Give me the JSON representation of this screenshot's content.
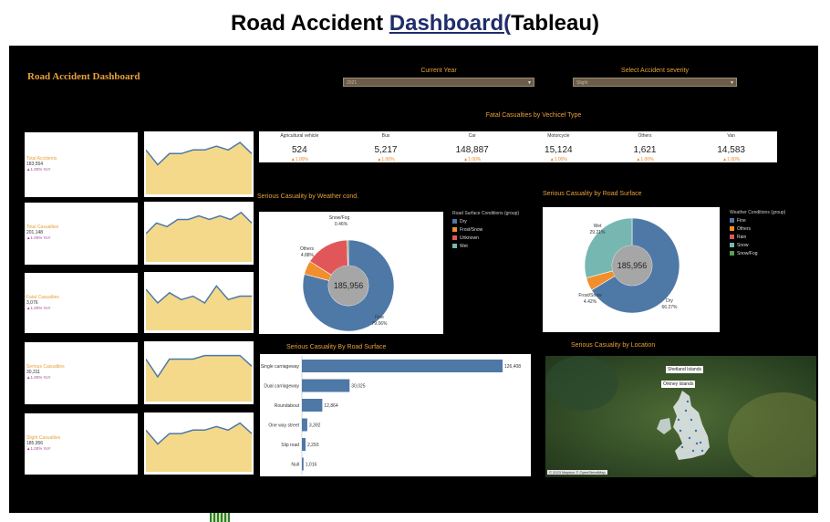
{
  "page_title": {
    "part1": "Road Accid",
    "part2": "ent ",
    "part3": "Dashboard(",
    "part4": "Tableau)"
  },
  "dashboard": {
    "title": "Road Accident Dashboard",
    "filters": {
      "current_year": {
        "label": "Current Year",
        "value": "2021"
      },
      "severity": {
        "label": "Select Accident severity",
        "value": "Slight"
      }
    },
    "kpis": [
      {
        "label": "Total Accidents",
        "value": "183,554",
        "delta": "▲1.00% YoY"
      },
      {
        "label": "Total Casualties",
        "value": "201,148",
        "delta": "▲1.00% YoY"
      },
      {
        "label": "Fatal Casualties",
        "value": "3,076",
        "delta": "▲1.00% YoY"
      },
      {
        "label": "Serious Casualties",
        "value": "30,311",
        "delta": "▲1.00% YoY"
      },
      {
        "label": "Slight Casualties",
        "value": "185,956",
        "delta": "▲1.00% YoY"
      }
    ],
    "vehicle_table": {
      "title": "Fatal Casualties by Vechicel Type",
      "columns": [
        {
          "name": "Agricultural vehicle",
          "value": "524",
          "delta": "▲1.00%"
        },
        {
          "name": "Bus",
          "value": "5,217",
          "delta": "▲1.00%"
        },
        {
          "name": "Car",
          "value": "148,887",
          "delta": "▲1.00%"
        },
        {
          "name": "Motorcycle",
          "value": "15,124",
          "delta": "▲1.00%"
        },
        {
          "name": "Others",
          "value": "1,621",
          "delta": "▲1.00%"
        },
        {
          "name": "Van",
          "value": "14,583",
          "delta": "▲1.00%"
        }
      ]
    },
    "donut1": {
      "title": "Serious Casuality by Weather cond.",
      "legend_title": "Road Surface Conditions (group)",
      "legend": [
        {
          "name": "Dry",
          "color": "#4e79a7"
        },
        {
          "name": "Frost/Snow",
          "color": "#f28e2b"
        },
        {
          "name": "Unknown",
          "color": "#e15759"
        },
        {
          "name": "Wet",
          "color": "#76b7b2"
        }
      ],
      "center": "185,956",
      "labels": {
        "snow": "Snow/Fog",
        "snow_pct": "0.46%",
        "others": "Others",
        "others_pct": "4.88%",
        "fine": "Fine",
        "fine_pct": "79.06%"
      }
    },
    "donut2": {
      "title": "Serious Casuality by Road Surface",
      "legend_title": "Weather Conditions (group)",
      "legend": [
        {
          "name": "Fine",
          "color": "#4e79a7"
        },
        {
          "name": "Others",
          "color": "#f28e2b"
        },
        {
          "name": "Rain",
          "color": "#e15759"
        },
        {
          "name": "Snow",
          "color": "#76b7b2"
        },
        {
          "name": "Snow/Fog",
          "color": "#59a14f"
        }
      ],
      "center": "185,956",
      "labels": {
        "wet": "Wet",
        "wet_pct": "29.21%",
        "frost": "Frost/Snow",
        "frost_pct": "4.42%",
        "dry": "Dry",
        "dry_pct": "66.27%"
      }
    },
    "bar_title": "Serious Casuality By Road Surface",
    "map": {
      "title": "Serious Casuality by Location",
      "label1": "Shetland Islands",
      "label2": "Orkney Islands",
      "credit": "© 2023 Mapbox © OpenStreetMap"
    }
  },
  "chart_data": [
    {
      "type": "area",
      "title": "",
      "series": [
        {
          "values": [
            6,
            4,
            5.5,
            5.5,
            6,
            6,
            6.5,
            6,
            7,
            5.5
          ]
        }
      ]
    },
    {
      "type": "area",
      "title": "",
      "series": [
        {
          "values": [
            4,
            5.5,
            5,
            6,
            6,
            6.5,
            6,
            6.5,
            6,
            7,
            5.5
          ]
        }
      ]
    },
    {
      "type": "area",
      "title": "",
      "series": [
        {
          "values": [
            6,
            4,
            5.5,
            4.5,
            5,
            4,
            6.5,
            4.5,
            5,
            5
          ]
        }
      ]
    },
    {
      "type": "area",
      "title": "",
      "series": [
        {
          "values": [
            6,
            3.5,
            6,
            6,
            6,
            6.5,
            6.5,
            6.5,
            6.5,
            5
          ]
        }
      ]
    },
    {
      "type": "area",
      "title": "",
      "series": [
        {
          "values": [
            6,
            4,
            5.5,
            5.5,
            6,
            6,
            6.5,
            6,
            7,
            5.5
          ]
        }
      ]
    },
    {
      "type": "pie",
      "title": "Serious Casuality by Weather cond.",
      "slices": [
        {
          "label": "Fine",
          "value": 79.06,
          "color": "#4e79a7"
        },
        {
          "label": "Others",
          "value": 4.88,
          "color": "#f28e2b"
        },
        {
          "label": "Rain",
          "value": 15.6,
          "color": "#e15759"
        },
        {
          "label": "Snow/Fog",
          "value": 0.46,
          "color": "#59a14f"
        }
      ]
    },
    {
      "type": "pie",
      "title": "Serious Casuality by Road Surface",
      "slices": [
        {
          "label": "Dry",
          "value": 66.27,
          "color": "#4e79a7"
        },
        {
          "label": "Frost/Snow",
          "value": 4.42,
          "color": "#f28e2b"
        },
        {
          "label": "Wet",
          "value": 29.21,
          "color": "#76b7b2"
        }
      ]
    },
    {
      "type": "bar",
      "title": "Serious Casuality By Road Surface",
      "categories": [
        "Single carriageway",
        "Dual carriageway",
        "Roundabout",
        "One way street",
        "Slip road",
        "Null"
      ],
      "values": [
        126408,
        30025,
        12864,
        3392,
        2293,
        1016
      ],
      "value_labels": [
        "126,408",
        "30,025",
        "12,864",
        "3,392",
        "2,293",
        "1,016"
      ]
    }
  ]
}
